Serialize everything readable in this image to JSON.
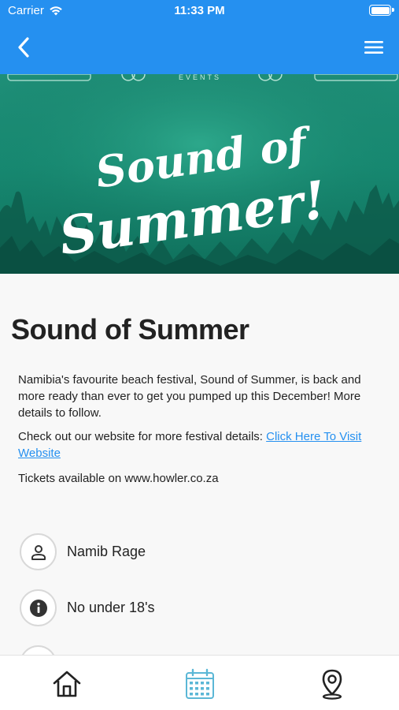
{
  "status_bar": {
    "carrier": "Carrier",
    "time": "11:33 PM"
  },
  "hero": {
    "line1": "Sound of",
    "line2": "Summer!",
    "small_text": "EVENTS"
  },
  "event": {
    "title": "Sound of Summer",
    "description": "Namibia's favourite beach festival, Sound of Summer, is back and more ready than ever to get you pumped up this December! More details to follow.",
    "website_prefix": "Check out our website for more festival details: ",
    "website_link": "Click Here To Visit Website",
    "tickets": "Tickets available on www.howler.co.za"
  },
  "info": [
    {
      "icon": "person-icon",
      "label": "Namib Rage"
    },
    {
      "icon": "info-icon",
      "label": "No under 18's"
    }
  ],
  "tabs": [
    {
      "icon": "home-icon"
    },
    {
      "icon": "calendar-icon",
      "active": true
    },
    {
      "icon": "map-pin-icon"
    }
  ],
  "colors": {
    "accent": "#2590f0",
    "hero_green": "#1f8f78",
    "text": "#222222"
  }
}
